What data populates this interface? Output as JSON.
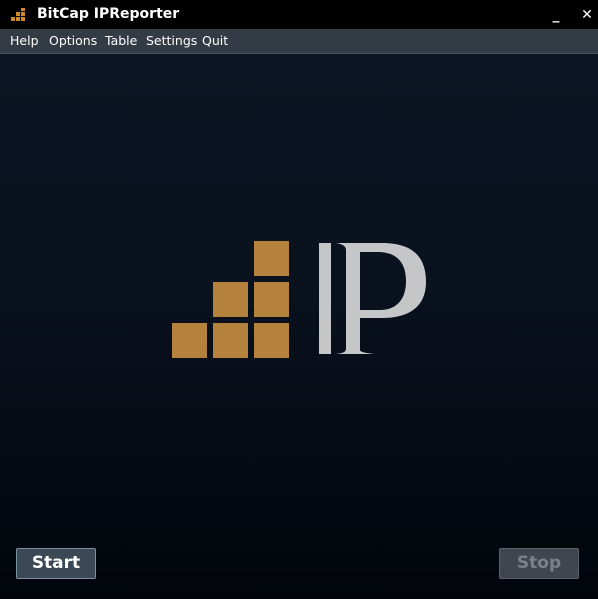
{
  "window": {
    "title": "BitCap IPReporter",
    "minimize_glyph": "_",
    "close_glyph": "✕"
  },
  "menu": {
    "items": [
      "Help",
      "Options",
      "Table",
      "Settings",
      "Quit"
    ]
  },
  "logo": {
    "letters": "IP",
    "block_color": "#b5823e",
    "letter_color": "#c4c6c8"
  },
  "buttons": {
    "start_label": "Start",
    "stop_label": "Stop"
  },
  "colors": {
    "accent": "#b5823e",
    "titlebar": "#000000",
    "menubar": "#333c44"
  }
}
